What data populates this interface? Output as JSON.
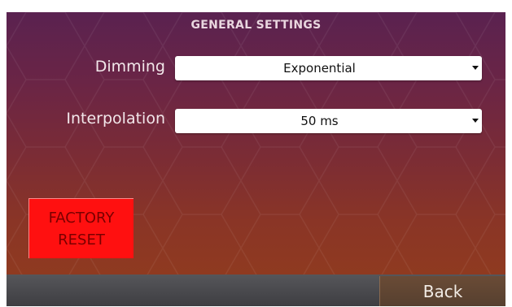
{
  "header": {
    "title": "GENERAL SETTINGS"
  },
  "settings": {
    "dimming": {
      "label": "Dimming",
      "value": "Exponential"
    },
    "interpolation": {
      "label": "Interpolation",
      "value": "50 ms"
    }
  },
  "factory_reset": {
    "line1": "FACTORY",
    "line2": "RESET"
  },
  "footer": {
    "back_label": "Back"
  },
  "colors": {
    "factory_reset_bg": "#ff1010",
    "back_button_bg": "#5e4432",
    "bottom_bar_bg": "#454548"
  },
  "icons": {
    "dropdown": "caret-down-icon"
  }
}
